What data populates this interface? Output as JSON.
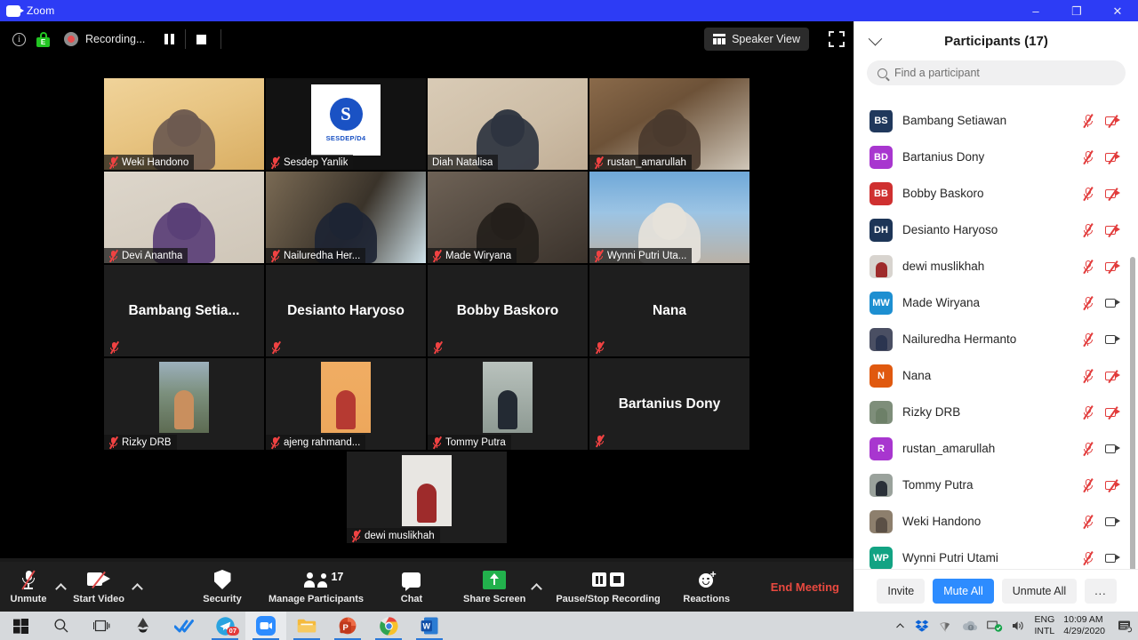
{
  "window": {
    "title": "Zoom",
    "icon": "zoom-camera-icon",
    "minimize": "–",
    "restore": "❐",
    "close": "✕"
  },
  "meeting_bar": {
    "info_icon": "info-icon",
    "encryption_icon": "encryption-lock-icon",
    "encryption_letter": "E",
    "recording_icon": "recording-dot-icon",
    "recording_label": "Recording...",
    "pause_recording_icon": "pause-icon",
    "stop_recording_icon": "stop-icon",
    "view_button": "Speaker View",
    "view_icon": "speaker-view-icon",
    "fullscreen_icon": "fullscreen-icon"
  },
  "stage": {
    "rows": [
      [
        {
          "name": "Weki Handono",
          "muted": true,
          "kind": "video",
          "active": false,
          "bg": "linear-gradient(160deg,#f0d39a 0%,#e8c583 45%,#d9ae63 100%)",
          "person": "#6c5a50"
        },
        {
          "name": "Sesdep Yanlik",
          "muted": true,
          "kind": "logo",
          "active": false,
          "bg": "#121212",
          "logo_text": "SESDEP/D4",
          "logo_letter": "S",
          "logo_color": "#1a52c4"
        },
        {
          "name": "Diah Natalisa",
          "muted": false,
          "kind": "video",
          "active": true,
          "bg": "linear-gradient(150deg,#d9cbb6 0%,#cdbda6 60%,#c0ad95 100%)",
          "person": "#2e3440"
        },
        {
          "name": "rustan_amarullah",
          "muted": true,
          "kind": "video",
          "active": false,
          "bg": "linear-gradient(150deg,#8a6a4a 0%,#6d5238 40%,#cfc6b8 100%)",
          "person": "#4a3a2e"
        }
      ],
      [
        {
          "name": "Devi Anantha",
          "muted": true,
          "kind": "video",
          "active": false,
          "bg": "linear-gradient(160deg,#ddd6cb 0%,#cfc6b8 100%)",
          "person": "#5a3f77"
        },
        {
          "name": "Nailuredha Her...",
          "muted": true,
          "kind": "video",
          "active": false,
          "bg": "linear-gradient(120deg,#7a6a54 0%,#3a332a 55%,#cfe2ea 100%)",
          "person": "#1d2433"
        },
        {
          "name": "Made Wiryana",
          "muted": true,
          "kind": "video",
          "active": false,
          "bg": "linear-gradient(150deg,#6e6256 0%,#3b332c 100%)",
          "person": "#241f1b"
        },
        {
          "name": "Wynni Putri Uta...",
          "muted": true,
          "kind": "video",
          "active": false,
          "bg": "linear-gradient(180deg,#6fa8d8 0%,#9cc4e4 45%,#b9b1a6 100%)",
          "person": "#e6e2da"
        }
      ],
      [
        {
          "name": "Bambang  Setia...",
          "muted": true,
          "kind": "name",
          "active": false,
          "bg": "#1e1e1e"
        },
        {
          "name": "Desianto Haryoso",
          "muted": true,
          "kind": "name",
          "active": false,
          "bg": "#1e1e1e"
        },
        {
          "name": "Bobby Baskoro",
          "muted": true,
          "kind": "name",
          "active": false,
          "bg": "#1e1e1e"
        },
        {
          "name": "Nana",
          "muted": true,
          "kind": "name",
          "active": false,
          "bg": "#1e1e1e"
        }
      ],
      [
        {
          "name": "Rizky DRB",
          "muted": true,
          "kind": "photo",
          "active": false,
          "bg": "#1e1e1e",
          "photo": "linear-gradient(180deg,#9cb0bd 0%,#7b8f7c 45%,#5d6b52 100%)",
          "person": "#c98f5e"
        },
        {
          "name": "ajeng rahmand...",
          "muted": true,
          "kind": "photo",
          "active": false,
          "bg": "#1e1e1e",
          "photo": "linear-gradient(180deg,#f0ad63 0%,#eda75c 100%)",
          "person": "#b63a32"
        },
        {
          "name": "Tommy Putra",
          "muted": true,
          "kind": "photo",
          "active": false,
          "bg": "#1e1e1e",
          "photo": "linear-gradient(180deg,#b9c2bd 0%,#8e9a93 100%)",
          "person": "#232a33"
        },
        {
          "name": "Bartanius Dony",
          "muted": true,
          "kind": "name",
          "active": false,
          "bg": "#1e1e1e"
        }
      ],
      [
        {
          "name": "dewi muslikhah",
          "muted": true,
          "kind": "photo",
          "active": false,
          "bg": "#1e1e1e",
          "photo": "#e8e6e2",
          "person": "#9e2b2b"
        }
      ]
    ]
  },
  "panel": {
    "collapse_icon": "chevron-down-icon",
    "title": "Participants (17)",
    "search_icon": "search-icon",
    "search_placeholder": "Find a participant",
    "search_value": "",
    "participants": [
      {
        "name": "Bambang Setiawan",
        "initials": "BS",
        "color": "#20385c",
        "avatar": "initials",
        "mic": "muted",
        "cam": "off",
        "partial": true
      },
      {
        "name": "Bartanius Dony",
        "initials": "BD",
        "color": "#a836cf",
        "avatar": "initials",
        "mic": "muted",
        "cam": "off"
      },
      {
        "name": "Bobby Baskoro",
        "initials": "BB",
        "color": "#cf3030",
        "avatar": "initials",
        "mic": "muted",
        "cam": "off"
      },
      {
        "name": "Desianto Haryoso",
        "initials": "DH",
        "color": "#1d3557",
        "avatar": "initials",
        "mic": "muted",
        "cam": "off"
      },
      {
        "name": "dewi muslikhah",
        "initials": "",
        "color": "#d8d4cf",
        "avatar": "photo",
        "photo": "#9e2b2b",
        "mic": "muted",
        "cam": "off"
      },
      {
        "name": "Made Wiryana",
        "initials": "MW",
        "color": "#1d8fd1",
        "avatar": "initials",
        "mic": "muted",
        "cam": "on"
      },
      {
        "name": "Nailuredha Hermanto",
        "initials": "",
        "color": "#4a4f63",
        "avatar": "photo",
        "photo": "#2b3550",
        "mic": "muted",
        "cam": "on"
      },
      {
        "name": "Nana",
        "initials": "N",
        "color": "#e0590f",
        "avatar": "initials",
        "mic": "muted",
        "cam": "off"
      },
      {
        "name": "Rizky DRB",
        "initials": "",
        "color": "#7e8e7a",
        "avatar": "photo",
        "photo": "#6d8068",
        "mic": "muted",
        "cam": "off"
      },
      {
        "name": "rustan_amarullah",
        "initials": "R",
        "color": "#a836cf",
        "avatar": "initials",
        "mic": "muted",
        "cam": "on"
      },
      {
        "name": "Tommy Putra",
        "initials": "",
        "color": "#9aa29c",
        "avatar": "photo",
        "photo": "#2a3038",
        "mic": "muted",
        "cam": "off"
      },
      {
        "name": "Weki Handono",
        "initials": "",
        "color": "#8d7f6d",
        "avatar": "photo",
        "photo": "#5b5046",
        "mic": "muted",
        "cam": "on"
      },
      {
        "name": "Wynni Putri Utami",
        "initials": "WP",
        "color": "#12a383",
        "avatar": "initials",
        "mic": "muted",
        "cam": "on"
      }
    ],
    "footer": {
      "invite": "Invite",
      "mute_all": "Mute All",
      "unmute_all": "Unmute All",
      "more": "..."
    }
  },
  "toolbar": {
    "unmute": {
      "label": "Unmute",
      "icon": "microphone-muted-icon"
    },
    "audio_options_icon": "chevron-up-icon",
    "start_video": {
      "label": "Start Video",
      "icon": "camera-off-icon"
    },
    "video_options_icon": "chevron-up-icon",
    "security": {
      "label": "Security",
      "icon": "shield-icon"
    },
    "manage_participants": {
      "label": "Manage Participants",
      "icon": "people-icon",
      "count": "17"
    },
    "chat": {
      "label": "Chat",
      "icon": "chat-bubble-icon"
    },
    "share_screen": {
      "label": "Share Screen",
      "icon": "share-screen-icon"
    },
    "share_options_icon": "chevron-up-icon",
    "recording": {
      "label": "Pause/Stop Recording",
      "icon": "pause-stop-recording-icon"
    },
    "reactions": {
      "label": "Reactions",
      "icon": "reactions-smiley-icon"
    },
    "end_meeting": "End Meeting"
  },
  "taskbar": {
    "items": [
      {
        "name": "start-button",
        "icon": "windows-logo-icon"
      },
      {
        "name": "search-button",
        "icon": "search-icon"
      },
      {
        "name": "task-view-button",
        "icon": "task-view-icon"
      },
      {
        "name": "inkscape-app",
        "icon": "inkscape-icon"
      },
      {
        "name": "todoist-app",
        "icon": "checkmark-icon"
      },
      {
        "name": "telegram-app",
        "icon": "telegram-icon",
        "badge": "07",
        "running": true
      },
      {
        "name": "zoom-app",
        "icon": "zoom-icon",
        "active": true,
        "running": true
      },
      {
        "name": "file-explorer-app",
        "icon": "folder-icon",
        "running": true
      },
      {
        "name": "powerpoint-app",
        "icon": "powerpoint-icon",
        "running": true
      },
      {
        "name": "chrome-app",
        "icon": "chrome-icon",
        "running": true
      },
      {
        "name": "word-app",
        "icon": "word-icon",
        "running": true
      }
    ],
    "tray": {
      "show_hidden_icon": "chevron-up-icon",
      "dropbox_icon": "dropbox-icon",
      "wifi_icon": "wifi-icon",
      "onedrive_icon": "onedrive-icon",
      "display_icon": "display-icon",
      "volume_icon": "speaker-icon",
      "language_line1": "ENG",
      "language_line2": "INTL",
      "time": "10:09 AM",
      "date": "4/29/2020",
      "notifications_icon": "notifications-icon"
    }
  }
}
